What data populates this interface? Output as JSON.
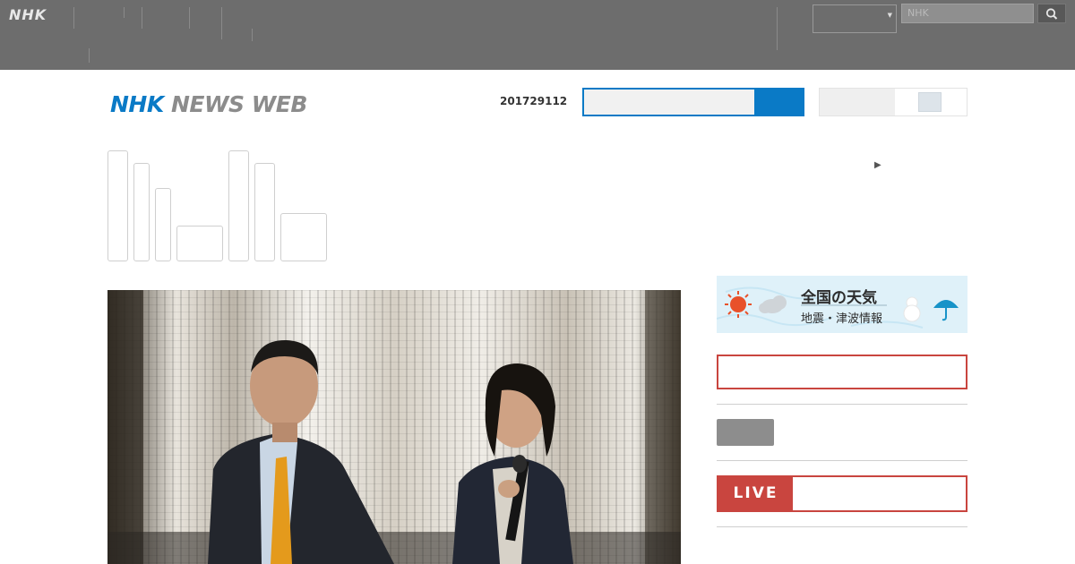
{
  "topbar": {
    "logo": "NHK",
    "nav": [
      {
        "label": "ﾠﾠ\nﾠﾠ"
      },
      {
        "label": "ﾠﾠﾠ\nﾠﾠﾠ"
      },
      {
        "label": "ﾠﾠ"
      },
      {
        "label": "ﾠﾠﾠﾠ\nﾠﾠﾠ"
      },
      {
        "label": "ﾠﾠﾠ\nﾠﾠﾠ"
      },
      {
        "label": "ﾠﾠ\nﾠﾠﾠﾠ\nﾠﾠﾠ"
      }
    ],
    "util_a": "ﾠﾠ\nﾠﾠ",
    "util_b": "ﾠﾠﾠ\nﾠﾠﾠ",
    "language_value": "ﾠﾠ",
    "search_placeholder": "NHK"
  },
  "header": {
    "logo_nhk": "NHK",
    "logo_rest": "NEWS WEB",
    "date": "201729112",
    "font_size_label": "ﾠﾠﾠﾠﾠ"
  },
  "categories": [
    {
      "label": ""
    },
    {
      "label": ""
    },
    {
      "label": ""
    },
    {
      "label": "ﾠﾠﾠﾠ\nﾠﾠ"
    },
    {
      "label": ""
    },
    {
      "label": ""
    },
    {
      "label": "ﾠﾠﾠ\nﾠﾠﾠﾠ"
    }
  ],
  "more_link": "ﾠﾠﾠﾠﾠﾠﾠﾠﾠﾠ",
  "right": {
    "weather_title": "全国の天気",
    "weather_sub": "地震・津波情報",
    "alert_text": "ﾠﾠﾠﾠﾠﾠﾠﾠﾠﾠﾠﾠﾠﾠﾠﾠﾠﾠﾠﾠ",
    "side_link": "ﾠﾠﾠﾠﾠﾠ",
    "live_badge": "LIVE",
    "live_text": "ﾠﾠﾠ ﾠﾠﾠﾠﾠﾠﾠﾠﾠﾠ"
  },
  "colors": {
    "brand_blue": "#0a7ac6",
    "alert_red": "#c9453f",
    "topbar_gray": "#6d6d6d",
    "link_blue": "#0a6a9e"
  }
}
